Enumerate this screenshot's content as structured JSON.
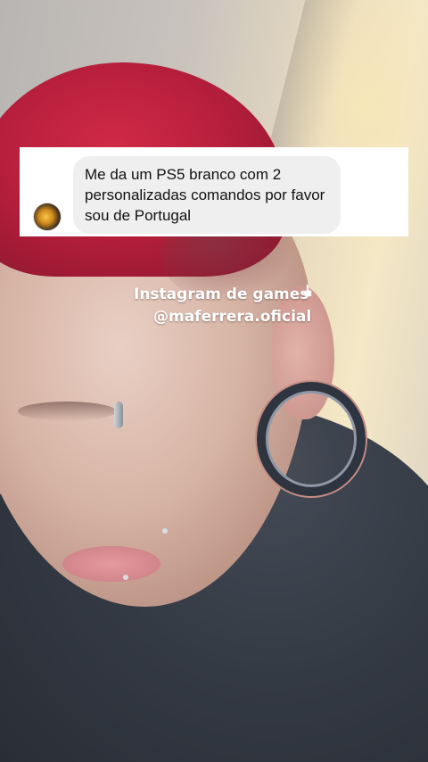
{
  "reply_sticker": {
    "message": "Me da um PS5 branco com 2\npersonalizadas comandos por favor\nsou de Portugal",
    "avatar_icon": "avatar-icon"
  },
  "overlay": {
    "caption_line1": "Instagram de games",
    "caption_line2": "@maferrera.oficial",
    "pointer_icon": "hand-pointer-icon"
  },
  "colors": {
    "sticker_background": "#ffffff",
    "bubble_background": "#efefef",
    "caption_text": "#ffffff",
    "hair": "#c8253f"
  }
}
